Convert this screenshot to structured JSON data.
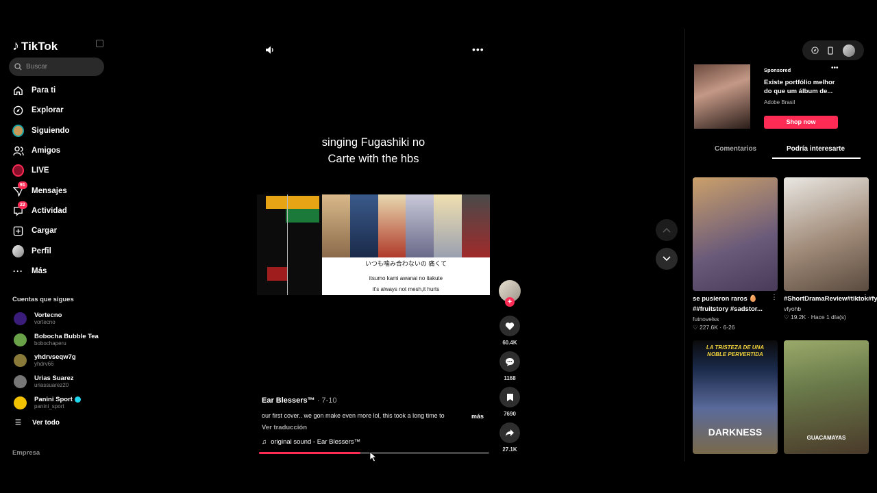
{
  "sidebar": {
    "brand": "TikTok",
    "search_placeholder": "Buscar",
    "nav": [
      {
        "label": "Para ti",
        "icon": "home-icon"
      },
      {
        "label": "Explorar",
        "icon": "compass-icon"
      },
      {
        "label": "Siguiendo",
        "icon": "following-avatar-icon"
      },
      {
        "label": "Amigos",
        "icon": "friends-icon"
      },
      {
        "label": "LIVE",
        "icon": "live-icon"
      },
      {
        "label": "Mensajes",
        "icon": "messages-icon",
        "badge": "91"
      },
      {
        "label": "Actividad",
        "icon": "activity-icon",
        "badge": "22"
      },
      {
        "label": "Cargar",
        "icon": "upload-icon"
      },
      {
        "label": "Perfil",
        "icon": "profile-avatar-icon"
      },
      {
        "label": "Más",
        "icon": "more-dots-icon"
      }
    ],
    "following_title": "Cuentas que sigues",
    "accounts": [
      {
        "name": "Vortecno",
        "handle": "vortecno",
        "color": "#3a1d7a"
      },
      {
        "name": "Bobocha Bubble Tea",
        "handle": "bobochaperu",
        "color": "#6aa24a"
      },
      {
        "name": "yhdrvseqw7g",
        "handle": "yhdrv66",
        "color": "#8a7a3a"
      },
      {
        "name": "Urias Suarez",
        "handle": "uriassuarez20",
        "color": "#777777"
      },
      {
        "name": "Panini Sport",
        "handle": "panini_sport",
        "color": "#f2c200",
        "verified": true
      }
    ],
    "see_all": "Ver todo",
    "footer": "Empresa"
  },
  "video": {
    "overlay_line1": "singing Fugashiki no",
    "overlay_line2": "Carte with the hbs",
    "lyric_jp": "いつも噛み合わないの 痛くて",
    "lyric_romaji": "itsumo kami awanai no itakute",
    "lyric_en": "it's always not mesh,it hurts",
    "author": "Ear Blessers™",
    "date": " · 7-10",
    "caption": "our first cover.. we gon make even more lol, this took a long time to",
    "more": "más",
    "translate": "Ver traducción",
    "sound": "original sound - Ear Blessers™",
    "progress": 0.44
  },
  "actions": {
    "likes": "60.4K",
    "comments": "1168",
    "saves": "7690",
    "shares": "27.1K"
  },
  "right": {
    "ad": {
      "sponsored": "Sponsored",
      "title": "Existe portfólio melhor do que um álbum de...",
      "brand": "Adobe Brasil",
      "cta": "Shop now"
    },
    "tabs": [
      "Comentarios",
      "Podría interesarte"
    ],
    "cards": [
      {
        "title": "se pusieron raros 🥚 ##fruitstory #sadstor...",
        "author": "futnovelss",
        "likes": "227.6K",
        "date": "6-26",
        "c1": "#caa06a",
        "c2": "#4a3a5a"
      },
      {
        "title": "#ShortDramaReview#tiktok#fyp#foryoupage",
        "author": "vfyohb",
        "likes": "19.2K",
        "date": "Hace 1 día(s)",
        "c1": "#e9e7e2",
        "c2": "#5a4b3f"
      },
      {
        "overlay": "LA TRISTEZA DE UNA NOBLE PERVERTIDA",
        "overlay2": "DARKNESS",
        "c1": "#1a2a4a",
        "c2": "#7a6a4a"
      },
      {
        "overlay2": "GUACAMAYAS",
        "c1": "#8a9a5a",
        "c2": "#4a3a2a"
      }
    ]
  }
}
